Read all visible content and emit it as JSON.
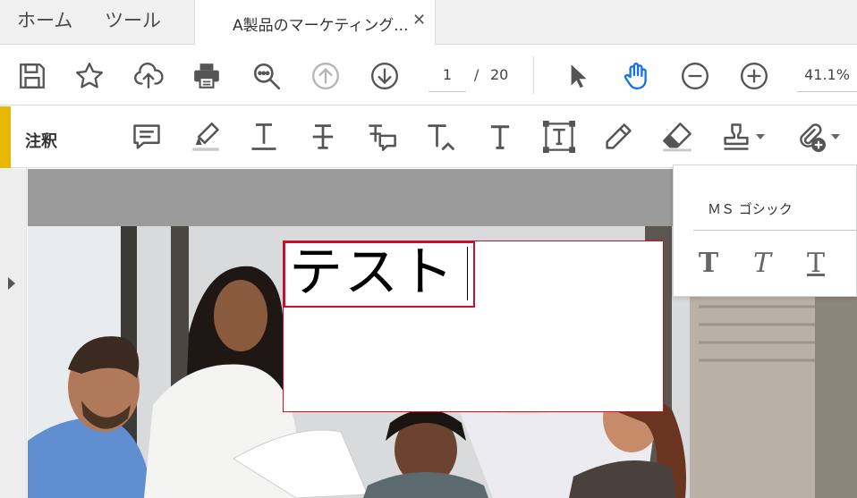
{
  "tabs": {
    "home": "ホーム",
    "tools": "ツール",
    "document_title": "A製品のマーケティング...",
    "close_glyph": "✕"
  },
  "toolbar": {
    "icons": [
      "save-icon",
      "star-icon",
      "upload-cloud-icon",
      "print-icon",
      "zoom-search-icon",
      "page-up-icon",
      "page-down-icon",
      "select-arrow-icon",
      "hand-icon",
      "zoom-out-icon",
      "zoom-in-icon"
    ],
    "page_current": "1",
    "page_separator": "/",
    "page_total": "20",
    "zoom": "41.1%",
    "accent_color": "#1473e6"
  },
  "comment_toolbar": {
    "label": "注釈",
    "accent_color": "#e8b800",
    "tools": [
      "sticky-note-icon",
      "highlight-icon",
      "underline-text-icon",
      "strikethrough-icon",
      "replace-text-icon",
      "insert-text-icon",
      "add-text-comment-icon",
      "text-box-icon",
      "pencil-icon",
      "eraser-icon",
      "stamp-icon",
      "attach-file-icon"
    ]
  },
  "annotation": {
    "text": "テスト",
    "border_color": "#c8102e"
  },
  "font_panel": {
    "font_name": "ＭＳ ゴシック",
    "bold_glyph": "T",
    "italic_glyph": "T",
    "underline_glyph": "T"
  }
}
